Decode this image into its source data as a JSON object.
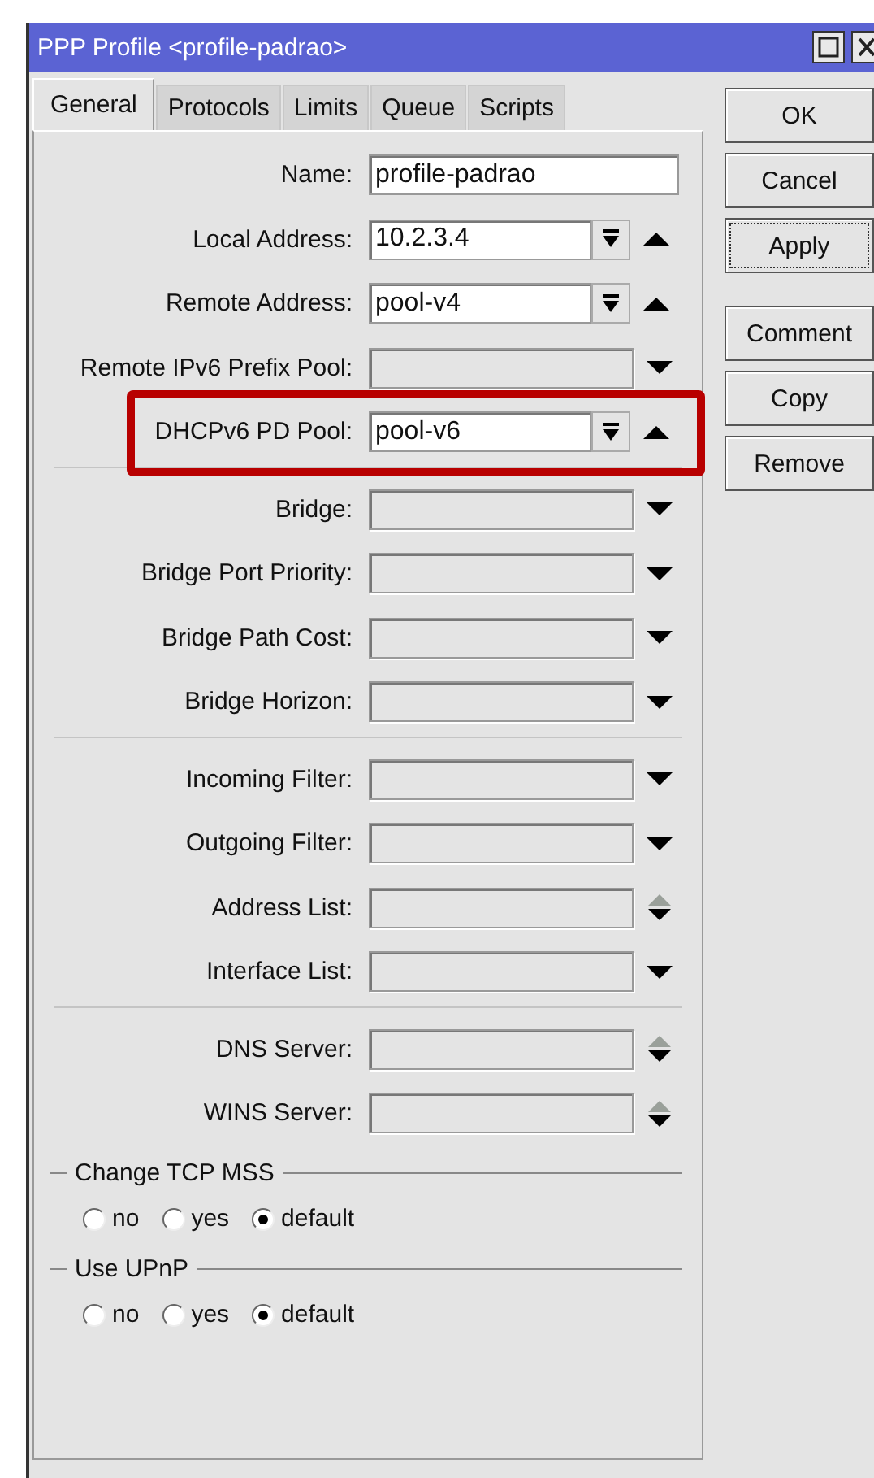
{
  "window": {
    "title": "PPP Profile <profile-padrao>"
  },
  "tabs": [
    {
      "label": "General",
      "selected": true
    },
    {
      "label": "Protocols",
      "selected": false
    },
    {
      "label": "Limits",
      "selected": false
    },
    {
      "label": "Queue",
      "selected": false
    },
    {
      "label": "Scripts",
      "selected": false
    }
  ],
  "sections": [
    [
      {
        "label": "Name:",
        "kind": "text",
        "value": "profile-padrao",
        "highlighted": false
      },
      {
        "label": "Local Address:",
        "kind": "combo",
        "value": "10.2.3.4",
        "highlighted": false
      },
      {
        "label": "Remote Address:",
        "kind": "combo",
        "value": "pool-v4",
        "highlighted": false
      },
      {
        "label": "Remote IPv6 Prefix Pool:",
        "kind": "dropdown",
        "highlighted": false
      },
      {
        "label": "DHCPv6 PD Pool:",
        "kind": "combo",
        "value": "pool-v6",
        "highlighted": true
      }
    ],
    [
      {
        "label": "Bridge:",
        "kind": "dropdown",
        "highlighted": false
      },
      {
        "label": "Bridge Port Priority:",
        "kind": "dropdown",
        "highlighted": false
      },
      {
        "label": "Bridge Path Cost:",
        "kind": "dropdown",
        "highlighted": false
      },
      {
        "label": "Bridge Horizon:",
        "kind": "dropdown",
        "highlighted": false
      }
    ],
    [
      {
        "label": "Incoming Filter:",
        "kind": "dropdown",
        "highlighted": false
      },
      {
        "label": "Outgoing Filter:",
        "kind": "dropdown",
        "highlighted": false
      },
      {
        "label": "Address List:",
        "kind": "list",
        "highlighted": false
      },
      {
        "label": "Interface List:",
        "kind": "dropdown",
        "highlighted": false
      }
    ],
    [
      {
        "label": "DNS Server:",
        "kind": "list",
        "highlighted": false
      },
      {
        "label": "WINS Server:",
        "kind": "list",
        "highlighted": false
      }
    ]
  ],
  "radio_groups": [
    {
      "title": "Change TCP MSS",
      "options": [
        {
          "label": "no",
          "selected": false
        },
        {
          "label": "yes",
          "selected": false
        },
        {
          "label": "default",
          "selected": true
        }
      ]
    },
    {
      "title": "Use UPnP",
      "options": [
        {
          "label": "no",
          "selected": false
        },
        {
          "label": "yes",
          "selected": false
        },
        {
          "label": "default",
          "selected": true
        }
      ]
    }
  ],
  "buttons": [
    {
      "label": "OK",
      "focused": false
    },
    {
      "label": "Cancel",
      "focused": false
    },
    {
      "label": "Apply",
      "focused": true
    },
    {
      "label": "Comment",
      "focused": false
    },
    {
      "label": "Copy",
      "focused": false
    },
    {
      "label": "Remove",
      "focused": false
    }
  ]
}
